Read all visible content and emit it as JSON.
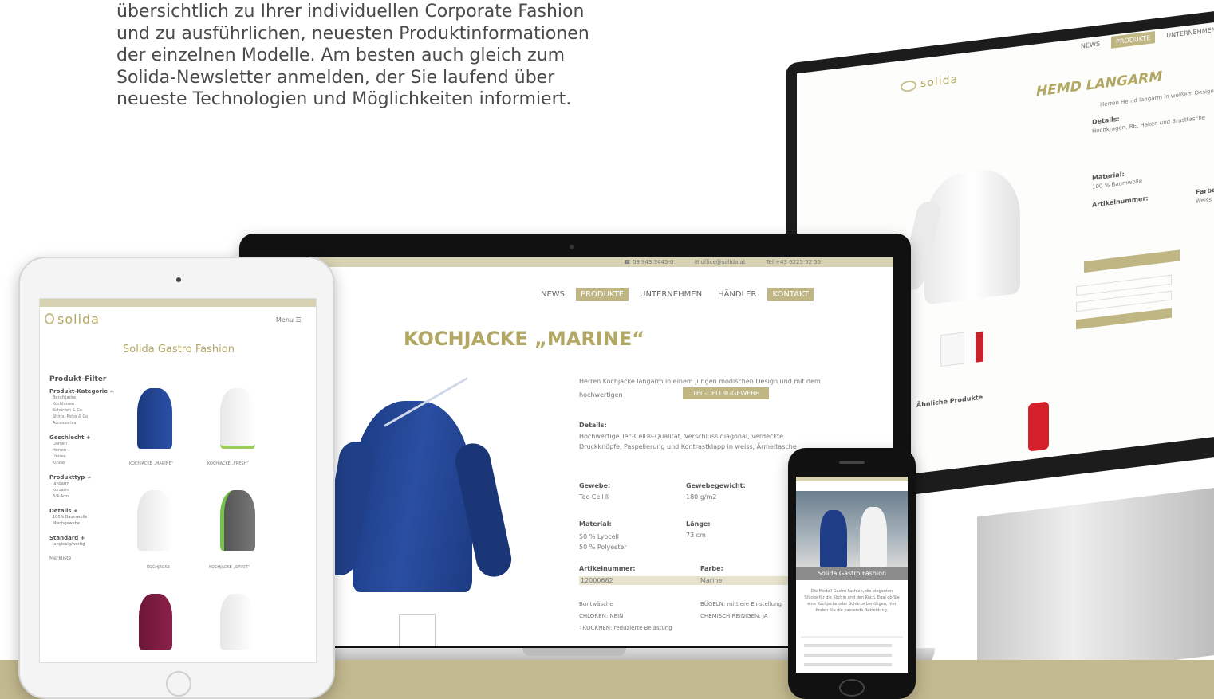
{
  "intro": {
    "lines": [
      "übersichtlich zu Ihrer individuellen Corporate Fashion",
      "und zu ausführlichen, neuesten Produktinformationen",
      "der einzelnen Modelle. Am besten auch gleich zum",
      "Solida-Newsletter anmelden, der Sie laufend über",
      "neueste Technologien und Möglichkeiten informiert."
    ]
  },
  "colors": {
    "brand": "#bfb683",
    "ground": "#c2b98e",
    "navy": "#1f3f87"
  },
  "laptop": {
    "logo": "solida",
    "topbar": [
      "☎ 09 943 3445-0",
      "✉ office@solida.at",
      "Tel +43 6225 52 55"
    ],
    "nav": [
      "NEWS",
      "PRODUKTE",
      "UNTERNEHMEN",
      "HÄNDLER",
      "KONTAKT"
    ],
    "title": "KOCHJACKE „MARINE“",
    "intro_text": "Herren Kochjacke langarm in einem jungen modischen Design und mit dem hochwertigen",
    "intro_button": "TEC-CELL®-GEWEBE",
    "details_label": "Details:",
    "details_text": "Hochwertige Tec-Cell®-Qualität, Verschluss diagonal, verdeckte Druckknöpfe, Paspelierung und Kontrastklapp in weiss, Ärmeltasche",
    "specs": [
      {
        "label": "Gewebe:",
        "value": "Tec-Cell®"
      },
      {
        "label": "Gewebegewicht:",
        "value": "180 g/m2"
      },
      {
        "label": "Material:",
        "value": "50 % Lyocell\n50 % Polyester"
      },
      {
        "label": "Länge:",
        "value": "73 cm"
      },
      {
        "label": "Artikelnummer:",
        "value": "12000682"
      },
      {
        "label": "Farbe:",
        "value": "Marine"
      }
    ],
    "care": [
      "Buntwäsche",
      "CHLOREN: NEIN",
      "TROCKNEN: reduzierte Belastung",
      "BÜGELN: mittlere Einstellung",
      "CHEMISCH REINIGEN: JA"
    ]
  },
  "tablet": {
    "logo": "solida",
    "menu": "Menu ☰",
    "heading": "Solida Gastro Fashion",
    "filter_title": "Produkt-Filter",
    "filter_groups": [
      {
        "title": "Produkt-Kategorie +",
        "items": [
          "Berufsjacke",
          "Kochhosen",
          "Schürzen & Co",
          "Shirts, Polos & Co",
          "Accessories"
        ]
      },
      {
        "title": "Geschlecht +",
        "items": [
          "Damen",
          "Herren",
          "Unisex",
          "Kinder"
        ]
      },
      {
        "title": "Produkttyp +",
        "items": [
          "langarm",
          "kurzarm",
          "3/4-Arm"
        ]
      },
      {
        "title": "Details +",
        "items": [
          "100% Baumwolle",
          "Mischgewebe"
        ]
      },
      {
        "title": "Standard +",
        "items": [
          "langlebig/wertig"
        ]
      }
    ],
    "wishlist": "Merkliste",
    "products": [
      "KOCHJACKE „MARINE“",
      "KOCHJACKE „FRESH“",
      "KOCHJACKE",
      "KOCHJACKE „SPIRIT“",
      "",
      ""
    ]
  },
  "imac": {
    "logo": "solida",
    "nav": [
      "NEWS",
      "PRODUKTE",
      "UNTERNEHMEN"
    ],
    "title": "HEMD LANGARM",
    "sub": "Herren Hemd langarm in weißem Design",
    "details_label": "Details:",
    "details_text": "Hochkragen, RE, Haken und Brusttasche",
    "material_label": "Material:",
    "material_value": "100 % Baumwolle",
    "artikel_label": "Artikelnummer:",
    "farbe_label": "Farbe:",
    "farbe_value": "Weiss",
    "related": "Ähnliche Produkte"
  },
  "phone": {
    "heading": "Solida Gastro Fashion",
    "text": "Die Modell Gastro Fashion, die eleganten Stücke für die Köchin und den Koch. Egal ob Sie eine Kochjacke oder Schürze benötigen, hier finden Sie die passende Bekleidung."
  }
}
